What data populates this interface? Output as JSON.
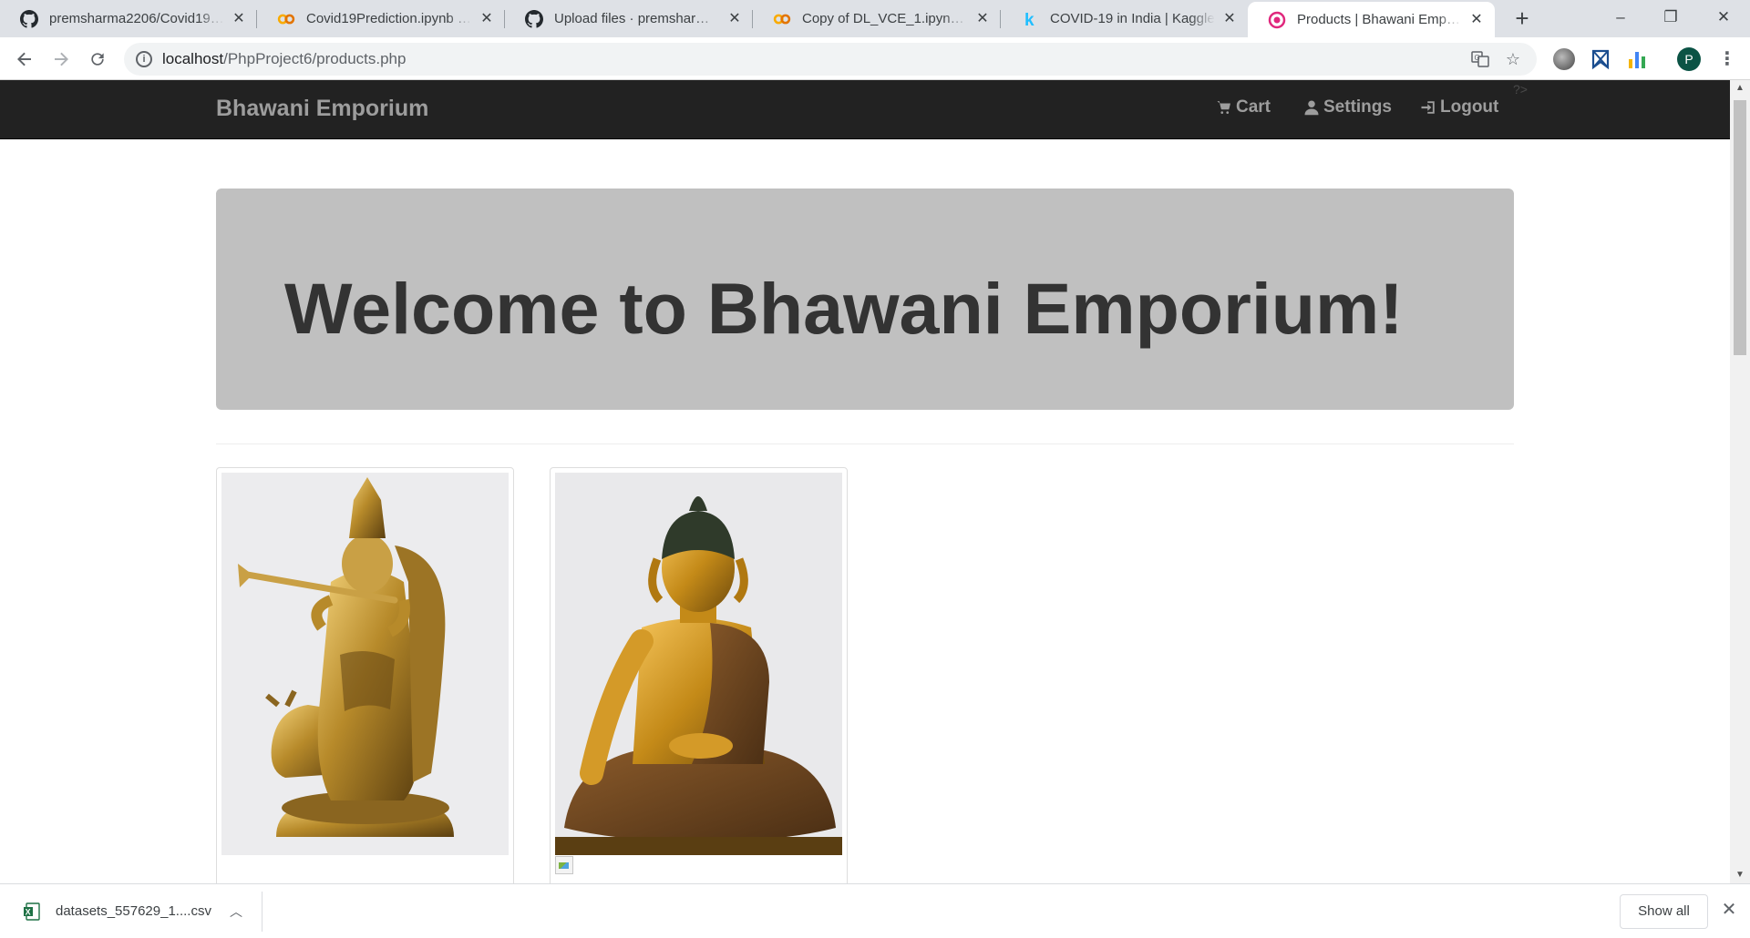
{
  "browser": {
    "tabs": [
      {
        "title": "premsharma2206/Covid19prediction",
        "icon": "github-icon"
      },
      {
        "title": "Covid19Prediction.ipynb - Colaboratory",
        "icon": "colab-icon"
      },
      {
        "title": "Upload files · premsharma2206",
        "icon": "github-icon"
      },
      {
        "title": "Copy of DL_VCE_1.ipynb - Colaboratory",
        "icon": "colab-icon"
      },
      {
        "title": "COVID-19 in India | Kaggle",
        "icon": "kaggle-icon"
      },
      {
        "title": "Products | Bhawani Emporium",
        "icon": "site-favicon-icon",
        "active": true
      }
    ],
    "new_tab": "+",
    "window_controls": {
      "minimize": "–",
      "restore": "❐",
      "close": "✕"
    },
    "url_host": "localhost",
    "url_path": "/PhpProject6/products.php",
    "profile_initial": "P"
  },
  "site": {
    "brand": "Bhawani Emporium",
    "nav": [
      {
        "label": "Cart",
        "icon": "cart-icon"
      },
      {
        "label": "Settings",
        "icon": "user-icon"
      },
      {
        "label": "Logout",
        "icon": "logout-icon"
      }
    ],
    "stray_text": "?>",
    "heading": "Welcome to Bhawani Emporium!",
    "products": [
      {
        "image": "krishna-statue-image"
      },
      {
        "image": "buddha-statue-image"
      }
    ]
  },
  "downloads": {
    "filename": "datasets_557629_1....csv",
    "show_all": "Show all"
  }
}
